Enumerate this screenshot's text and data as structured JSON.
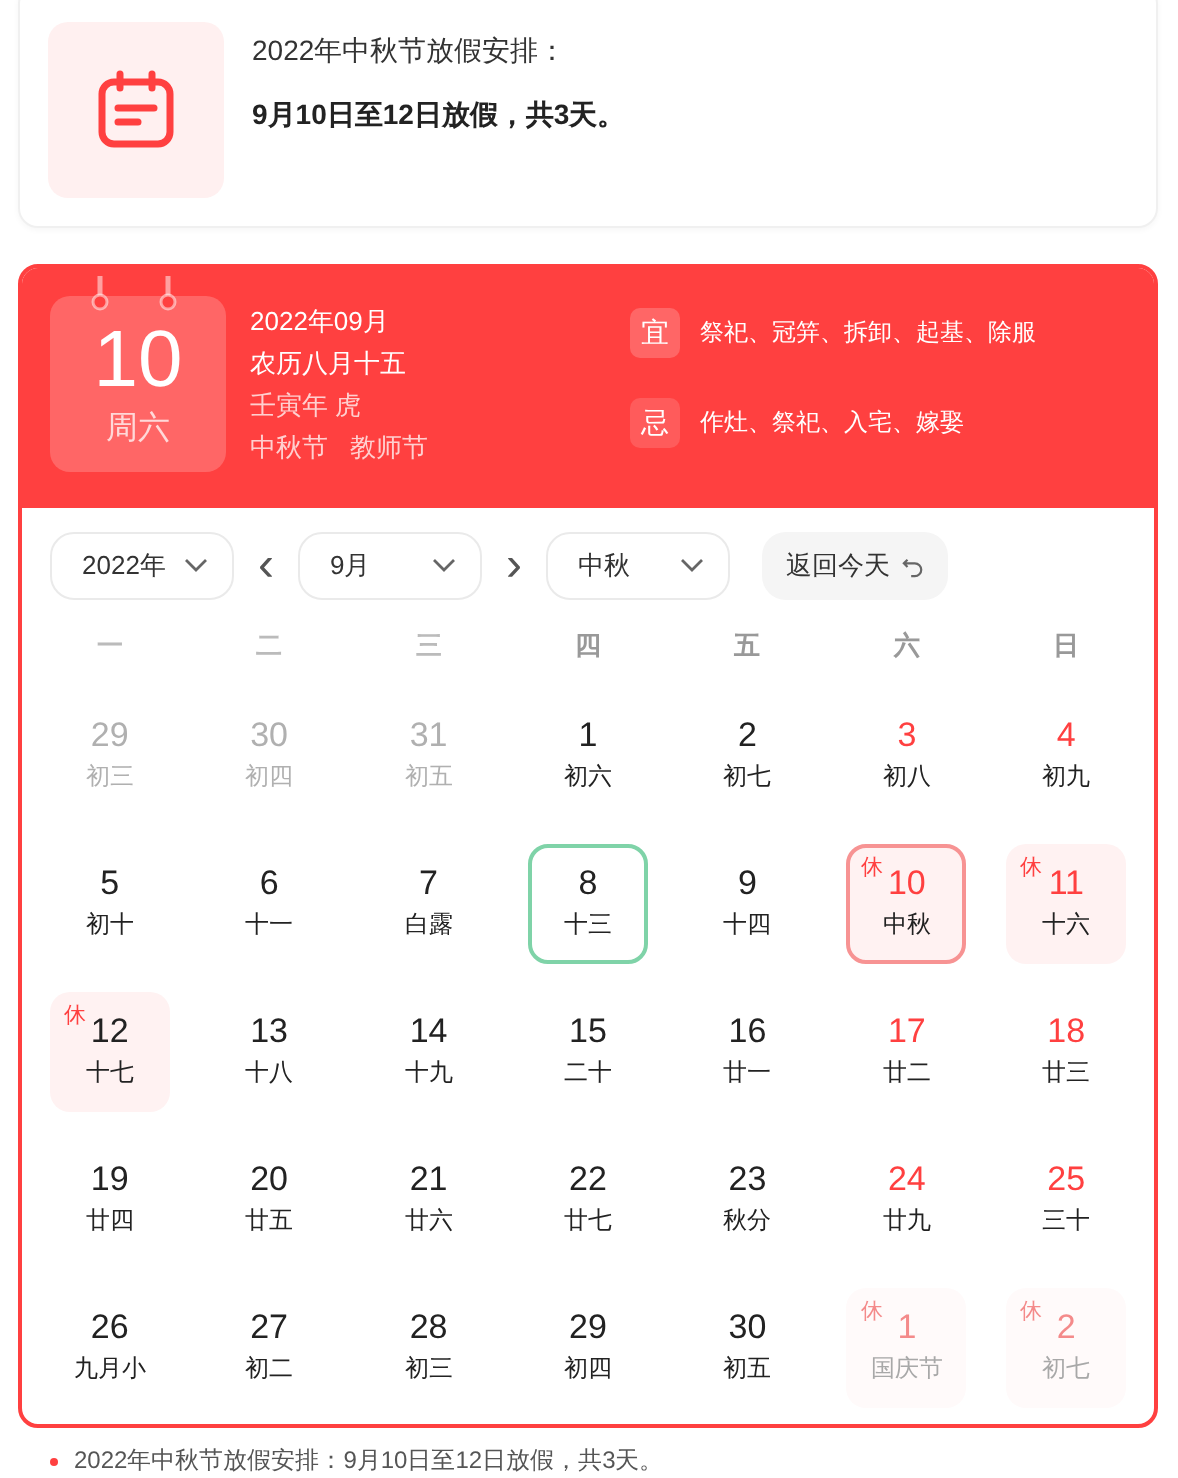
{
  "notice": {
    "title": "2022年中秋节放假安排：",
    "detail": "9月10日至12日放假，共3天。"
  },
  "header": {
    "day": "10",
    "weekday": "周六",
    "month": "2022年09月",
    "lunar": "农历八月十五",
    "ganzhi": "壬寅年 虎",
    "festivals": "中秋节   教师节",
    "almanac": [
      {
        "kind": "good",
        "label": "宜",
        "text": "祭祀、冠笄、拆卸、起基、除服"
      },
      {
        "kind": "bad",
        "label": "忌",
        "text": "作灶、祭祀、入宅、嫁娶"
      }
    ]
  },
  "controls": {
    "year": "2022年",
    "prev": "‹",
    "month": "9月",
    "next": "›",
    "holiday": "中秋",
    "today_button": "返回今天"
  },
  "weekdays": [
    "一",
    "二",
    "三",
    "四",
    "五",
    "六",
    "日"
  ],
  "days": [
    {
      "day": "29",
      "lunar": "初三",
      "kind": "prev",
      "rest": false,
      "selected": false,
      "today": false
    },
    {
      "day": "30",
      "lunar": "初四",
      "kind": "prev",
      "rest": false,
      "selected": false,
      "today": false
    },
    {
      "day": "31",
      "lunar": "初五",
      "kind": "prev",
      "rest": false,
      "selected": false,
      "today": false
    },
    {
      "day": "1",
      "lunar": "初六",
      "kind": "current",
      "weekend": false,
      "rest": false,
      "selected": false,
      "today": false
    },
    {
      "day": "2",
      "lunar": "初七",
      "kind": "current",
      "weekend": false,
      "rest": false,
      "selected": false,
      "today": false
    },
    {
      "day": "3",
      "lunar": "初八",
      "kind": "current",
      "weekend": true,
      "rest": false,
      "selected": false,
      "today": false
    },
    {
      "day": "4",
      "lunar": "初九",
      "kind": "current",
      "weekend": true,
      "rest": false,
      "selected": false,
      "today": false
    },
    {
      "day": "5",
      "lunar": "初十",
      "kind": "current",
      "weekend": false,
      "rest": false,
      "selected": false,
      "today": false
    },
    {
      "day": "6",
      "lunar": "十一",
      "kind": "current",
      "weekend": false,
      "rest": false,
      "selected": false,
      "today": false
    },
    {
      "day": "7",
      "lunar": "白露",
      "kind": "current",
      "weekend": false,
      "rest": false,
      "selected": false,
      "today": false
    },
    {
      "day": "8",
      "lunar": "十三",
      "kind": "current",
      "weekend": false,
      "rest": false,
      "selected": false,
      "today": true
    },
    {
      "day": "9",
      "lunar": "十四",
      "kind": "current",
      "weekend": false,
      "rest": false,
      "selected": false,
      "today": false
    },
    {
      "day": "10",
      "lunar": "中秋",
      "kind": "current",
      "weekend": true,
      "rest": true,
      "selected": true,
      "today": false,
      "rest_label": "休"
    },
    {
      "day": "11",
      "lunar": "十六",
      "kind": "current",
      "weekend": true,
      "rest": true,
      "selected": false,
      "today": false,
      "rest_label": "休"
    },
    {
      "day": "12",
      "lunar": "十七",
      "kind": "current",
      "weekend": false,
      "rest": true,
      "selected": false,
      "today": false,
      "rest_label": "休"
    },
    {
      "day": "13",
      "lunar": "十八",
      "kind": "current",
      "weekend": false,
      "rest": false,
      "selected": false,
      "today": false
    },
    {
      "day": "14",
      "lunar": "十九",
      "kind": "current",
      "weekend": false,
      "rest": false,
      "selected": false,
      "today": false
    },
    {
      "day": "15",
      "lunar": "二十",
      "kind": "current",
      "weekend": false,
      "rest": false,
      "selected": false,
      "today": false
    },
    {
      "day": "16",
      "lunar": "廿一",
      "kind": "current",
      "weekend": false,
      "rest": false,
      "selected": false,
      "today": false
    },
    {
      "day": "17",
      "lunar": "廿二",
      "kind": "current",
      "weekend": true,
      "rest": false,
      "selected": false,
      "today": false
    },
    {
      "day": "18",
      "lunar": "廿三",
      "kind": "current",
      "weekend": true,
      "rest": false,
      "selected": false,
      "today": false
    },
    {
      "day": "19",
      "lunar": "廿四",
      "kind": "current",
      "weekend": false,
      "rest": false,
      "selected": false,
      "today": false
    },
    {
      "day": "20",
      "lunar": "廿五",
      "kind": "current",
      "weekend": false,
      "rest": false,
      "selected": false,
      "today": false
    },
    {
      "day": "21",
      "lunar": "廿六",
      "kind": "current",
      "weekend": false,
      "rest": false,
      "selected": false,
      "today": false
    },
    {
      "day": "22",
      "lunar": "廿七",
      "kind": "current",
      "weekend": false,
      "rest": false,
      "selected": false,
      "today": false
    },
    {
      "day": "23",
      "lunar": "秋分",
      "kind": "current",
      "weekend": false,
      "rest": false,
      "selected": false,
      "today": false
    },
    {
      "day": "24",
      "lunar": "廿九",
      "kind": "current",
      "weekend": true,
      "rest": false,
      "selected": false,
      "today": false
    },
    {
      "day": "25",
      "lunar": "三十",
      "kind": "current",
      "weekend": true,
      "rest": false,
      "selected": false,
      "today": false
    },
    {
      "day": "26",
      "lunar": "九月小",
      "kind": "current",
      "weekend": false,
      "rest": false,
      "selected": false,
      "today": false
    },
    {
      "day": "27",
      "lunar": "初二",
      "kind": "current",
      "weekend": false,
      "rest": false,
      "selected": false,
      "today": false
    },
    {
      "day": "28",
      "lunar": "初三",
      "kind": "current",
      "weekend": false,
      "rest": false,
      "selected": false,
      "today": false
    },
    {
      "day": "29",
      "lunar": "初四",
      "kind": "current",
      "weekend": false,
      "rest": false,
      "selected": false,
      "today": false
    },
    {
      "day": "30",
      "lunar": "初五",
      "kind": "current",
      "weekend": false,
      "rest": false,
      "selected": false,
      "today": false
    },
    {
      "day": "1",
      "lunar": "国庆节",
      "kind": "next",
      "rest": true,
      "selected": false,
      "today": false,
      "rest_label": "休"
    },
    {
      "day": "2",
      "lunar": "初七",
      "kind": "next",
      "rest": true,
      "selected": false,
      "today": false,
      "rest_label": "休"
    }
  ],
  "footnote": "2022年中秋节放假安排：9月10日至12日放假，共3天。"
}
